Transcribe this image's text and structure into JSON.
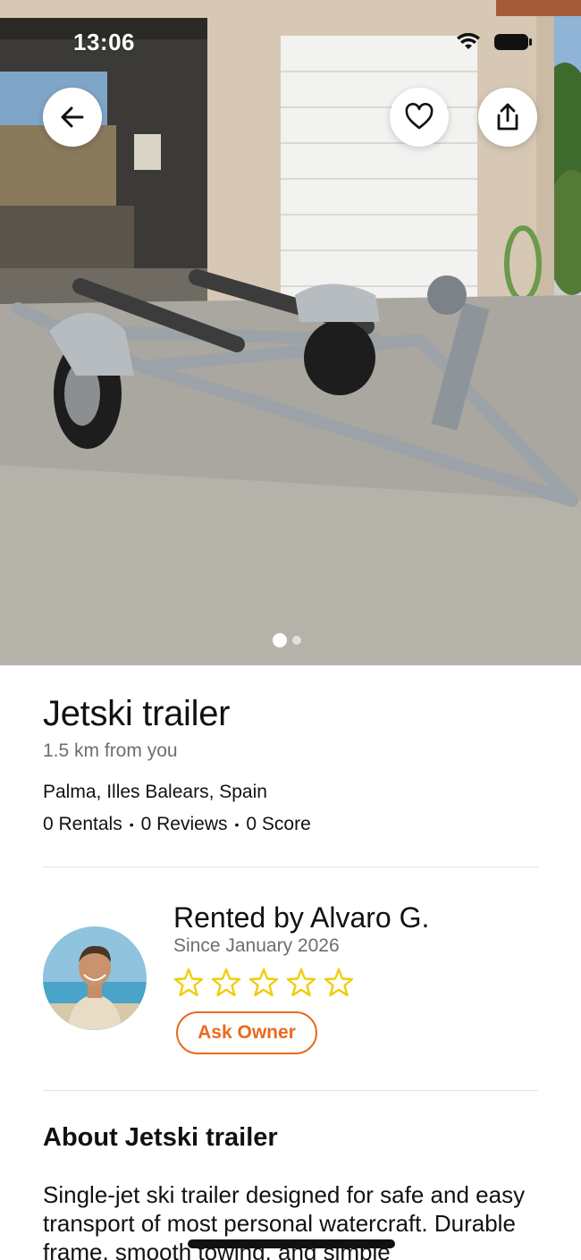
{
  "status_bar": {
    "time": "13:06"
  },
  "gallery": {
    "image_count": 2,
    "active_index": 0
  },
  "header_actions": {
    "back_icon": "arrow-left-icon",
    "favorite_icon": "heart-outline-icon",
    "share_icon": "share-icon"
  },
  "listing": {
    "title": "Jetski trailer",
    "distance": "1.5 km from you",
    "location": "Palma, Illes Balears, Spain",
    "rentals": "0 Rentals",
    "reviews": "0 Reviews",
    "score": "0 Score",
    "separator": "•"
  },
  "owner": {
    "rented_by": "Rented by Alvaro G.",
    "since": "Since January 2026",
    "rating": 0,
    "max_rating": 5,
    "ask_label": "Ask Owner"
  },
  "about": {
    "title": "About Jetski trailer",
    "text": "Single-jet ski trailer designed for safe and easy transport of most personal watercraft. Durable frame, smooth towing, and simple"
  },
  "colors": {
    "accent": "#ea6a1d",
    "star": "#f2cc0c",
    "muted_text": "#6e6e6e"
  }
}
